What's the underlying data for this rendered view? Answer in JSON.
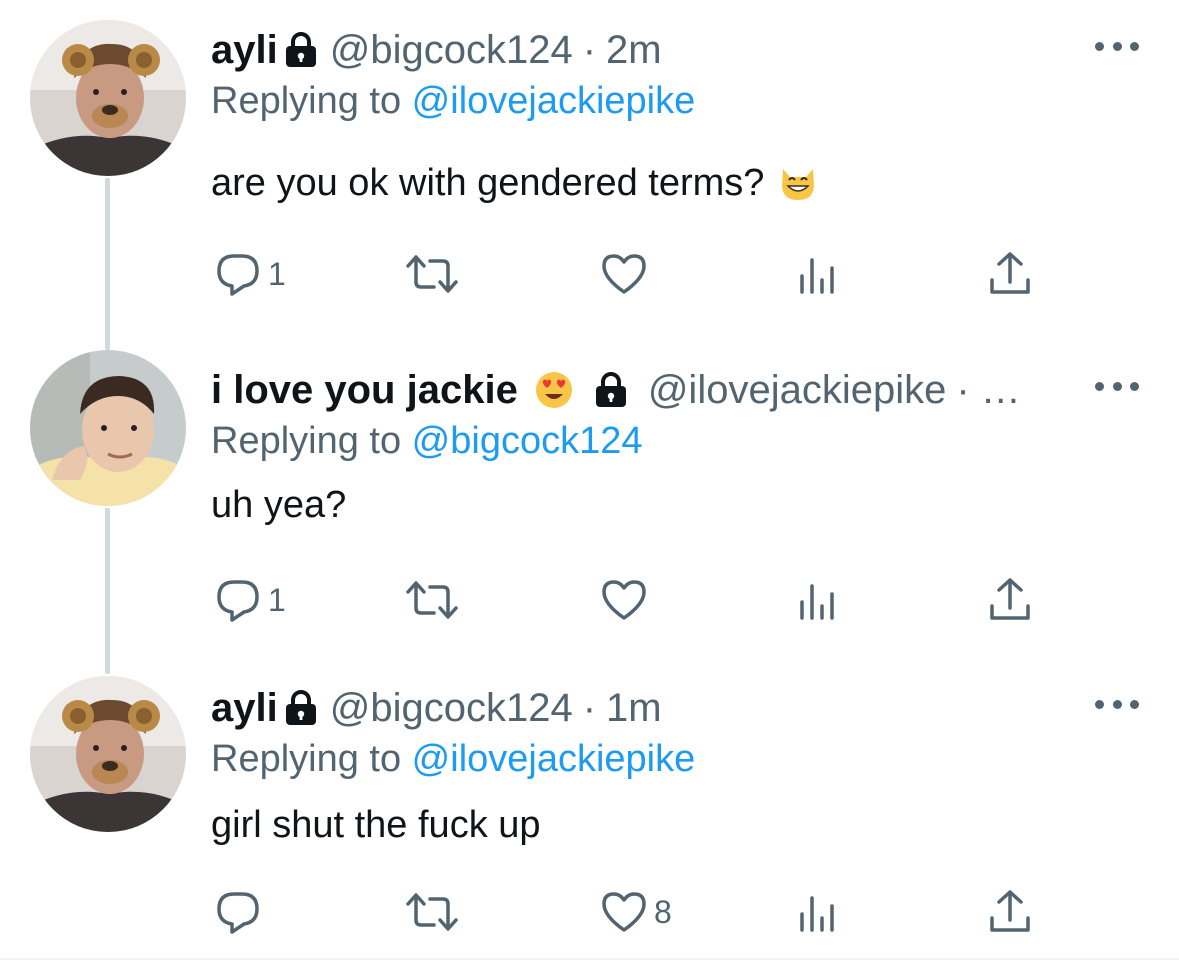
{
  "tweets": [
    {
      "name": "ayli",
      "handle": "@bigcock124",
      "separator": "·",
      "time": "2m",
      "reply_prefix": "Replying to ",
      "reply_to": "@ilovejackiepike",
      "text": "are you ok with gendered terms?",
      "text_emoji": "grinning-cat-emoji",
      "reply_count": "1",
      "retweet_count": "",
      "like_count": ""
    },
    {
      "name": "i love you jackie",
      "name_emoji": "heart-eyes-emoji",
      "handle": "@ilovejackiepike",
      "separator": "· …",
      "time": "",
      "reply_prefix": "Replying to ",
      "reply_to": "@bigcock124",
      "text": "uh yea?",
      "reply_count": "1",
      "retweet_count": "",
      "like_count": ""
    },
    {
      "name": "ayli",
      "handle": "@bigcock124",
      "separator": "·",
      "time": "1m",
      "reply_prefix": "Replying to ",
      "reply_to": "@ilovejackiepike",
      "text": "girl shut the fuck up",
      "reply_count": "",
      "retweet_count": "",
      "like_count": "8"
    }
  ],
  "icons": {
    "reply": "reply-icon",
    "retweet": "retweet-icon",
    "like": "heart-icon",
    "views": "views-icon",
    "share": "share-icon",
    "more": "more-icon",
    "lock": "lock-icon"
  },
  "colors": {
    "text": "#0f1419",
    "muted": "#536471",
    "link": "#1d9bf0",
    "thread_line": "#cfd9de"
  }
}
